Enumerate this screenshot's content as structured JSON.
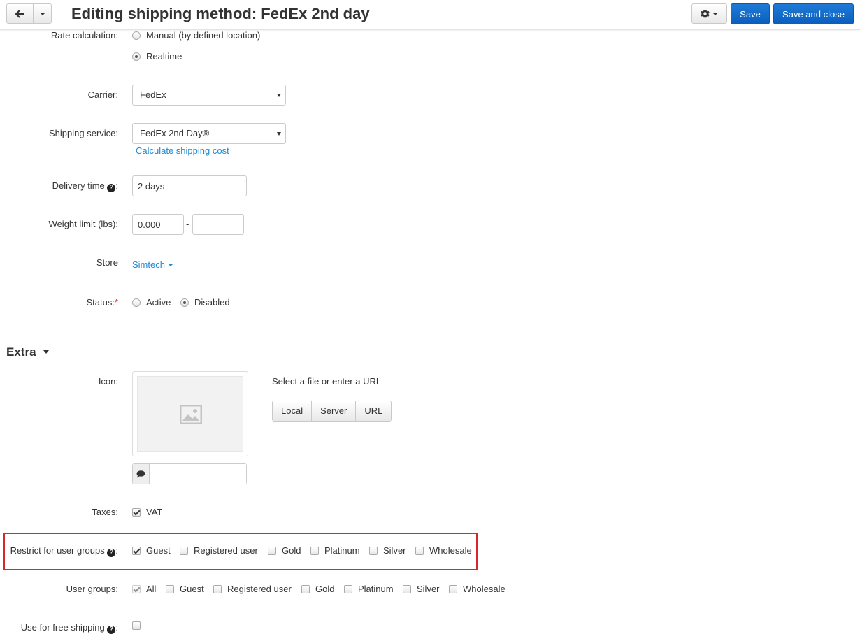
{
  "header": {
    "title": "Editing shipping method: FedEx 2nd day",
    "save_label": "Save",
    "save_close_label": "Save and close"
  },
  "rate_calculation": {
    "label": "Rate calculation:",
    "options": [
      "Manual (by defined location)",
      "Realtime"
    ],
    "selected": "Realtime"
  },
  "carrier": {
    "label": "Carrier:",
    "value": "FedEx"
  },
  "shipping_service": {
    "label": "Shipping service:",
    "value": "FedEx 2nd Day®",
    "link": "Calculate shipping cost"
  },
  "delivery_time": {
    "label": "Delivery time",
    "value": "2 days"
  },
  "weight_limit": {
    "label": "Weight limit (lbs):",
    "min": "0.000",
    "max": "",
    "separator": "-"
  },
  "store": {
    "label": "Store",
    "value": "Simtech"
  },
  "status": {
    "label": "Status:",
    "required_mark": "*",
    "options": [
      "Active",
      "Disabled"
    ],
    "selected": "Disabled"
  },
  "extra": {
    "title": "Extra",
    "icon_label": "Icon:",
    "file_prompt": "Select a file or enter a URL",
    "file_buttons": [
      "Local",
      "Server",
      "URL"
    ],
    "alt_text": ""
  },
  "taxes": {
    "label": "Taxes:",
    "items": [
      {
        "name": "VAT",
        "checked": true
      }
    ]
  },
  "restrict_groups": {
    "label": "Restrict for user groups",
    "items": [
      {
        "name": "Guest",
        "checked": true
      },
      {
        "name": "Registered user",
        "checked": false
      },
      {
        "name": "Gold",
        "checked": false
      },
      {
        "name": "Platinum",
        "checked": false
      },
      {
        "name": "Silver",
        "checked": false
      },
      {
        "name": "Wholesale",
        "checked": false
      }
    ]
  },
  "user_groups": {
    "label": "User groups:",
    "items": [
      {
        "name": "All",
        "checked": true
      },
      {
        "name": "Guest",
        "checked": false
      },
      {
        "name": "Registered user",
        "checked": false
      },
      {
        "name": "Gold",
        "checked": false
      },
      {
        "name": "Platinum",
        "checked": false
      },
      {
        "name": "Silver",
        "checked": false
      },
      {
        "name": "Wholesale",
        "checked": false
      }
    ]
  },
  "free_shipping": {
    "label": "Use for free shipping",
    "checked": false
  },
  "colors": {
    "accent": "#1a8bd6",
    "primary_button": "#0b66c5",
    "highlight": "#d9262d"
  }
}
